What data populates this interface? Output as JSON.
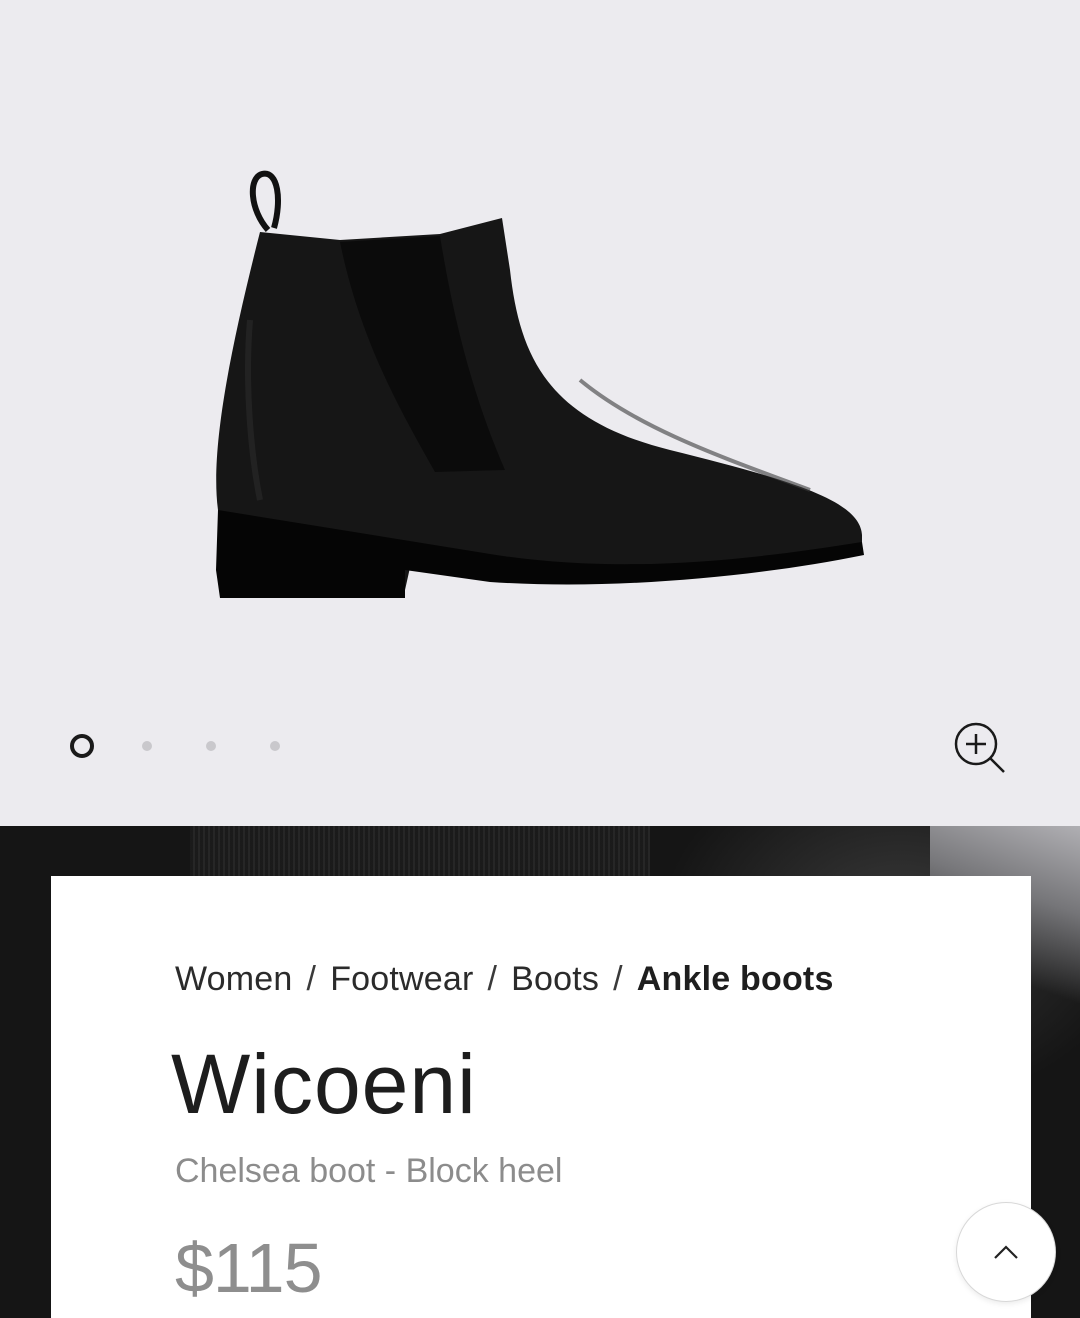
{
  "gallery": {
    "image_alt": "black chelsea ankle boot",
    "slides_total": 4,
    "active_slide": 1,
    "zoom_icon": "zoom-in-icon"
  },
  "breadcrumb": {
    "items": [
      "Women",
      "Footwear",
      "Boots"
    ],
    "separator": "/",
    "current": "Ankle boots"
  },
  "product": {
    "name": "Wicoeni",
    "subtitle": "Chelsea boot - Block heel",
    "price": "$115"
  },
  "scroll_top": {
    "icon": "chevron-up-icon"
  },
  "colors": {
    "background": "#ecebef",
    "card": "#ffffff",
    "text": "#1d1d1d",
    "muted": "#8c8c8c"
  }
}
